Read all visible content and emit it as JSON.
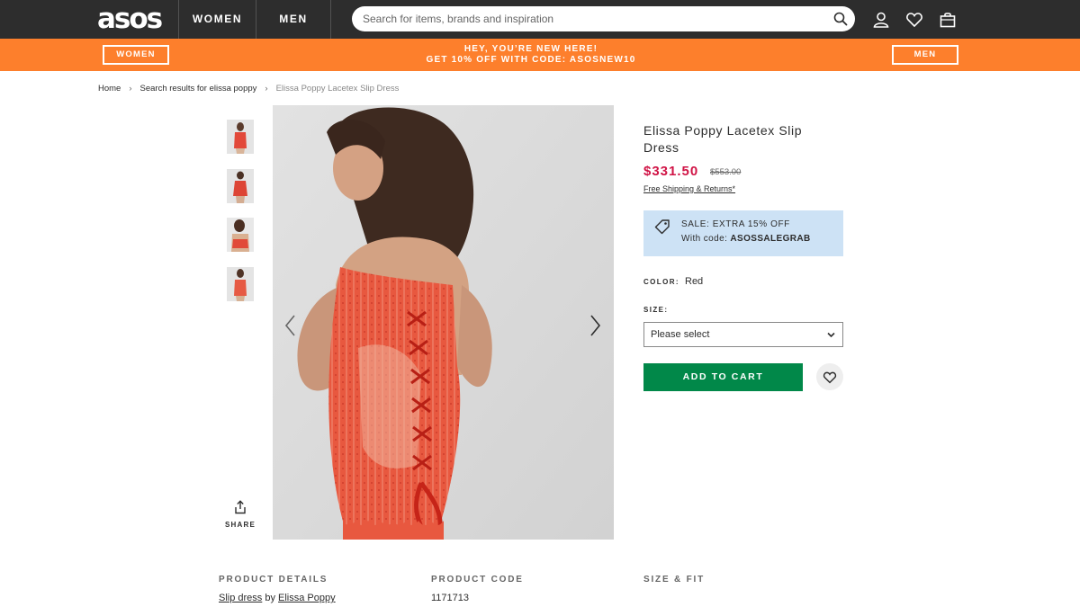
{
  "header": {
    "logo": "asos",
    "nav": [
      "WOMEN",
      "MEN"
    ],
    "search_placeholder": "Search for items, brands and inspiration",
    "icons": [
      "search-icon",
      "account-icon",
      "heart-icon",
      "bag-icon"
    ]
  },
  "promo": {
    "women_label": "WOMEN",
    "men_label": "MEN",
    "line1": "HEY, YOU’RE NEW HERE!",
    "line2": "GET 10% OFF WITH CODE: ASOSNEW10",
    "color": "#fd7f2c"
  },
  "breadcrumb": {
    "home": "Home",
    "search": "Search results for elissa poppy",
    "current": "Elissa Poppy Lacetex Slip Dress",
    "separator": "›"
  },
  "gallery": {
    "thumbnail_count": 4,
    "share_label": "SHARE"
  },
  "product": {
    "name": "Elissa Poppy Lacetex Slip Dress",
    "price": "$331.50",
    "was_price": "$553.00",
    "shipping": "Free Shipping & Returns*",
    "sale_line": "SALE: EXTRA 15% OFF",
    "sale_code_prefix": "With code: ",
    "sale_code": "ASOSSALEGRAB",
    "color_label": "COLOR:",
    "color_value": "Red",
    "size_label": "SIZE:",
    "size_value": "Please select",
    "add_to_cart": "ADD TO CART",
    "price_color": "#d01345",
    "cart_color": "#018849"
  },
  "details": {
    "product_details_head": "PRODUCT DETAILS",
    "product_code_head": "PRODUCT CODE",
    "size_fit_head": "SIZE & FIT",
    "desc_link1": "Slip dress",
    "desc_mid": " by ",
    "desc_link2": "Elissa Poppy",
    "code": "1171713"
  }
}
